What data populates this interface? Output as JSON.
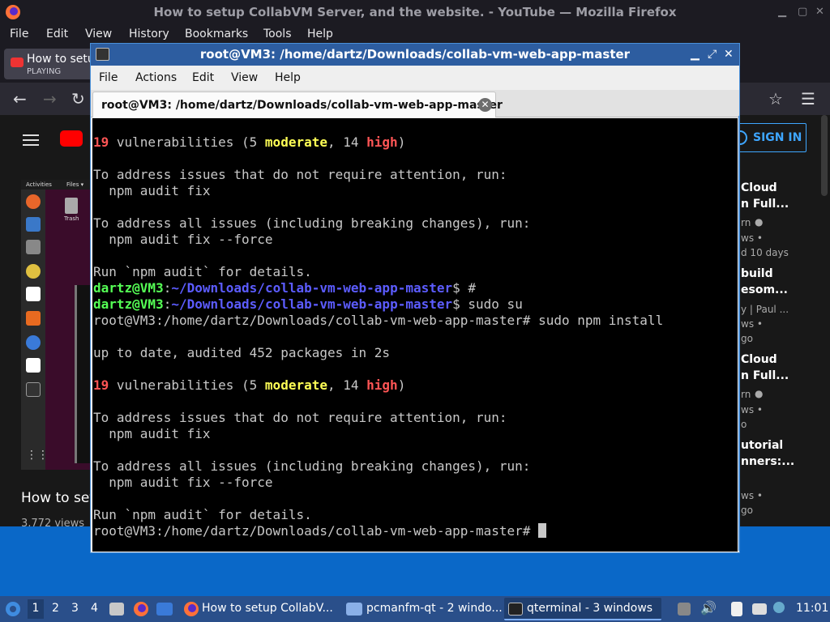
{
  "firefox": {
    "window_title": "How to setup CollabVM Server, and the website. - YouTube — Mozilla Firefox",
    "menu": [
      "File",
      "Edit",
      "View",
      "History",
      "Bookmarks",
      "Tools",
      "Help"
    ],
    "tab": {
      "title": "How to setu",
      "status": "PLAYING"
    },
    "youtube": {
      "sign_in": "SIGN IN",
      "video_title_partial": "How to set",
      "views_partial": "3,772 views",
      "dock_labels": {
        "activities": "Activities",
        "files": "Files ▾",
        "trash": "Trash"
      },
      "recommended": [
        {
          "title1": "Cloud",
          "title2": "n Full...",
          "meta1": "rn",
          "meta2": "ws •",
          "meta3": "d 10 days"
        },
        {
          "title1": "build",
          "title2": "esom...",
          "meta1": "y | Paul ...",
          "meta2": "ws •",
          "meta3": "go"
        },
        {
          "title1": "Cloud",
          "title2": "n Full...",
          "meta1": "rn",
          "meta2": "ws •",
          "meta3": "o"
        },
        {
          "title1": "utorial",
          "title2": "nners:...",
          "meta1": "",
          "meta2": "ws •",
          "meta3": "go"
        }
      ]
    }
  },
  "qterminal": {
    "window_title": "root@VM3: /home/dartz/Downloads/collab-vm-web-app-master",
    "menu": [
      "File",
      "Actions",
      "Edit",
      "View",
      "Help"
    ],
    "tab_title": "root@VM3: /home/dartz/Downloads/collab-vm-web-app-master",
    "lines": [
      [
        {
          "t": "19",
          "c": "r"
        },
        {
          "t": " vulnerabilities (5 "
        },
        {
          "t": "moderate",
          "c": "y"
        },
        {
          "t": ", 14 "
        },
        {
          "t": "high",
          "c": "r"
        },
        {
          "t": ")"
        }
      ],
      [],
      [
        {
          "t": "To address issues that do not require attention, run:"
        }
      ],
      [
        {
          "t": "  npm audit fix"
        }
      ],
      [],
      [
        {
          "t": "To address all issues (including breaking changes), run:"
        }
      ],
      [
        {
          "t": "  npm audit fix --force"
        }
      ],
      [],
      [
        {
          "t": "Run `npm audit` for details."
        }
      ],
      [
        {
          "t": "dartz@VM3",
          "c": "g"
        },
        {
          "t": ":"
        },
        {
          "t": "~/Downloads/collab-vm-web-app-master",
          "c": "b"
        },
        {
          "t": "$ #"
        }
      ],
      [
        {
          "t": "dartz@VM3",
          "c": "g"
        },
        {
          "t": ":"
        },
        {
          "t": "~/Downloads/collab-vm-web-app-master",
          "c": "b"
        },
        {
          "t": "$ sudo su"
        }
      ],
      [
        {
          "t": "root@VM3:/home/dartz/Downloads/collab-vm-web-app-master# sudo npm install"
        }
      ],
      [],
      [
        {
          "t": "up to date, audited 452 packages in 2s"
        }
      ],
      [],
      [
        {
          "t": "19",
          "c": "r"
        },
        {
          "t": " vulnerabilities (5 "
        },
        {
          "t": "moderate",
          "c": "y"
        },
        {
          "t": ", 14 "
        },
        {
          "t": "high",
          "c": "r"
        },
        {
          "t": ")"
        }
      ],
      [],
      [
        {
          "t": "To address issues that do not require attention, run:"
        }
      ],
      [
        {
          "t": "  npm audit fix"
        }
      ],
      [],
      [
        {
          "t": "To address all issues (including breaking changes), run:"
        }
      ],
      [
        {
          "t": "  npm audit fix --force"
        }
      ],
      [],
      [
        {
          "t": "Run `npm audit` for details."
        }
      ],
      [
        {
          "t": "root@VM3:/home/dartz/Downloads/collab-vm-web-app-master# "
        },
        {
          "t": "",
          "c": "cursor"
        }
      ]
    ]
  },
  "taskbar": {
    "desktops": [
      "1",
      "2",
      "3",
      "4"
    ],
    "tasks": [
      "How to setup CollabV...",
      "pcmanfm-qt - 2 windo...",
      "qterminal - 3 windows"
    ],
    "clock": "11:01"
  },
  "colors": {
    "terminal_bg": "#000000",
    "prompt_user": "#55ff55",
    "prompt_path": "#5c5cff",
    "error": "#ff5555",
    "warn": "#ffff55",
    "panel": "#2a4f8a",
    "titlebar": "#2d5da0"
  }
}
